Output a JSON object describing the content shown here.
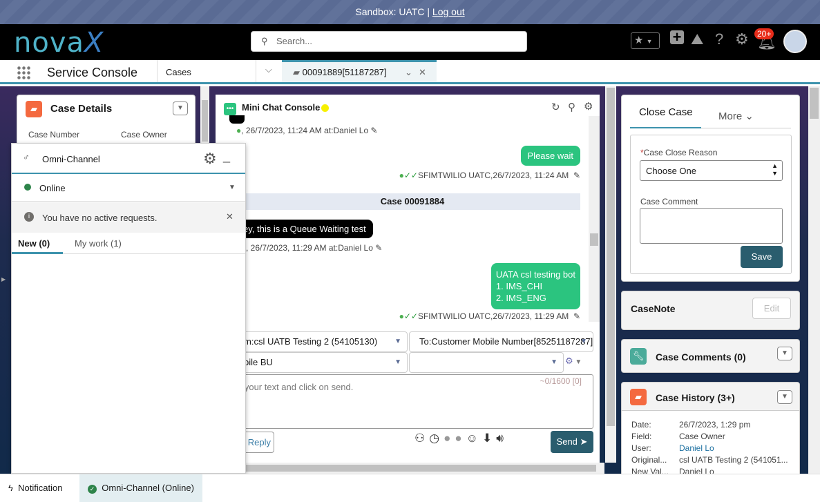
{
  "banner": {
    "sandbox": "Sandbox: UATC |",
    "logout": "Log out"
  },
  "header": {
    "logo_a": "nova",
    "logo_b": "X",
    "search_placeholder": "Search...",
    "notifications_badge": "20+"
  },
  "nav": {
    "app_name": "Service Console",
    "object_tab": "Cases",
    "workspace_tab": "00091889[51187287]"
  },
  "case_details": {
    "title": "Case Details",
    "labels": [
      "Case Number",
      "Case Owner"
    ]
  },
  "omni": {
    "title": "Omni-Channel",
    "status": "Online",
    "notice": "You have no active requests.",
    "tabs": [
      "New (0)",
      "My work (1)"
    ]
  },
  "chat": {
    "title": "Mini Chat Console",
    "status_color": "#f7f000",
    "messages": [
      {
        "dir": "meta-in",
        "meta": ", 26/7/2023, 11:24 AM at:Daniel Lo"
      },
      {
        "dir": "out",
        "text": "Please wait",
        "meta": "SFIMTWILIO UATC,26/7/2023, 11:24 AM"
      },
      {
        "dir": "divider",
        "text": "Case 00091884"
      },
      {
        "dir": "in",
        "text": "ey, this is a Queue Waiting test",
        "meta": ", 26/7/2023, 11:29 AM at:Daniel Lo"
      },
      {
        "dir": "out",
        "lines": [
          "UATA csl testing bot",
          "1. IMS_CHI",
          "2. IMS_ENG"
        ],
        "meta": "SFIMTWILIO UATC,26/7/2023, 11:29 AM"
      }
    ],
    "from": "m:csl UATB Testing 2 (54105130)",
    "to": "To:Customer Mobile Number[85251187287]",
    "bu": "bile BU",
    "template": "",
    "placeholder": "e your text and click on send.",
    "counter": "~0/1600 [0]",
    "reply": "Reply",
    "send": "Send"
  },
  "close_case": {
    "tab_active": "Close Case",
    "tab_more": "More",
    "reason_label": "Case Close Reason",
    "reason_value": "Choose One",
    "comment_label": "Case Comment",
    "save": "Save"
  },
  "case_note": {
    "title": "CaseNote",
    "edit": "Edit"
  },
  "case_comments": {
    "title": "Case Comments (0)"
  },
  "case_history": {
    "title": "Case History (3+)",
    "rows": [
      [
        "Date:",
        "26/7/2023, 1:29 pm"
      ],
      [
        "Field:",
        "Case Owner"
      ],
      [
        "User:",
        "Daniel Lo"
      ],
      [
        "Original...",
        "csl UATB Testing 2 (541051..."
      ],
      [
        "New Val...",
        "Daniel Lo"
      ]
    ]
  },
  "footer": {
    "notification": "Notification",
    "omni": "Omni-Channel (Online)"
  }
}
